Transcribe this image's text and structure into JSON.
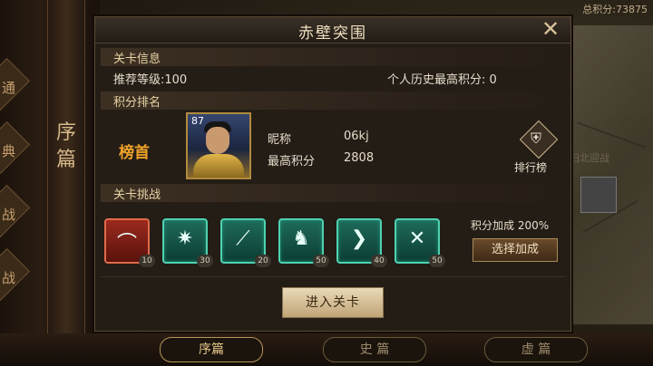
{
  "background": {
    "total_score": "总积分:73875",
    "scroll_text": "序篇",
    "left_tab_labels": [
      "通",
      "典",
      "战",
      "战"
    ],
    "map_label": "扫北迎战"
  },
  "dialog": {
    "title": "赤壁突围",
    "close_icon": "close-x-icon",
    "level_info": {
      "header": "关卡信息",
      "recommended_level": "推荐等级:100",
      "history_best": "个人历史最高积分: 0"
    },
    "ranking": {
      "header": "积分排名",
      "rank_label": "榜首",
      "portrait_level": "87",
      "nickname_label": "昵称",
      "nickname_value": "06kj",
      "best_score_label": "最高积分",
      "best_score_value": "2808",
      "leaderboard_label": "排行榜"
    },
    "challenge": {
      "header": "关卡挑战",
      "skills": [
        {
          "icon": "horn-icon",
          "count": "10",
          "color": "red"
        },
        {
          "icon": "burst-sword-icon",
          "count": "30",
          "color": "green"
        },
        {
          "icon": "blade-icon",
          "count": "20",
          "color": "green"
        },
        {
          "icon": "horse-icon",
          "count": "50",
          "color": "green"
        },
        {
          "icon": "chevron-right-icon",
          "count": "40",
          "color": "green"
        },
        {
          "icon": "crossed-swords-icon",
          "count": "50",
          "color": "green"
        }
      ],
      "bonus_text": "积分加成 200%",
      "select_bonus_label": "选择加成"
    },
    "enter_label": "进入关卡"
  },
  "bottom_tabs": [
    "序篇",
    "史 篇",
    "虚 篇"
  ],
  "colors": {
    "accent_gold": "#f0a32a",
    "skill_green": "#4fd1b0",
    "skill_red": "#e06a4a"
  }
}
